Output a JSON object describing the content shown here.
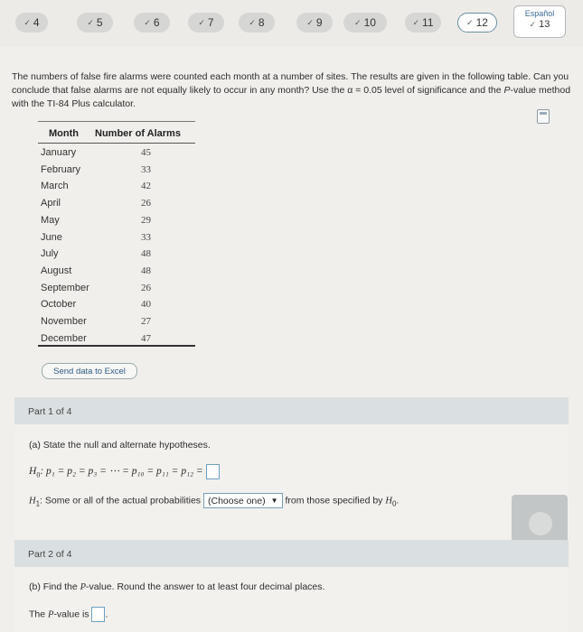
{
  "nav": {
    "questions": [
      {
        "label": "4",
        "check": "✓",
        "current": false
      },
      {
        "label": "5",
        "check": "✓",
        "current": false
      },
      {
        "label": "6",
        "check": "✓",
        "current": false
      },
      {
        "label": "7",
        "check": "✓",
        "current": false
      },
      {
        "label": "8",
        "check": "✓",
        "current": false
      },
      {
        "label": "9",
        "check": "✓",
        "current": false
      },
      {
        "label": "10",
        "check": "✓",
        "current": false
      },
      {
        "label": "11",
        "check": "✓",
        "current": false
      },
      {
        "label": "12",
        "check": "✓",
        "current": true
      }
    ],
    "language": {
      "label": "Español",
      "number": "13",
      "check": "✓"
    }
  },
  "question": {
    "text_1": "The numbers of false fire alarms were counted each month at a number of sites. The results are given in the following table. Can you conclude that false alarms are not equally likely to occur in any month? Use the α = 0.05 level of significance and the ",
    "text_italic": "P",
    "text_2": "-value method with the TI-84 Plus calculator."
  },
  "table": {
    "headers": [
      "Month",
      "Number of Alarms"
    ],
    "rows": [
      [
        "January",
        "45"
      ],
      [
        "February",
        "33"
      ],
      [
        "March",
        "42"
      ],
      [
        "April",
        "26"
      ],
      [
        "May",
        "29"
      ],
      [
        "June",
        "33"
      ],
      [
        "July",
        "48"
      ],
      [
        "August",
        "48"
      ],
      [
        "September",
        "26"
      ],
      [
        "October",
        "40"
      ],
      [
        "November",
        "27"
      ],
      [
        "December",
        "47"
      ]
    ]
  },
  "send_button": "Send data to Excel",
  "part1": {
    "title": "Part 1 of 4",
    "instruction": "(a) State the null and alternate hypotheses.",
    "h0_label": "H",
    "h0_sub": "0",
    "h0_expr": ": p₁ = p₂ = p₃ = ⋯ = p₁₀ = p₁₁ = p₁₂ =",
    "h1_label": "H",
    "h1_sub": "1",
    "h1_text": ": Some or all of the actual probabilities",
    "dropdown_value": "(Choose one)",
    "dropdown_arrow": "▼",
    "h1_text_2": "from those specified by",
    "h1_ref": "H",
    "h1_ref_sub": "0",
    "h1_end": "."
  },
  "part2": {
    "title": "Part 2 of 4",
    "instruction_1": "(b) Find the ",
    "instruction_italic": "P",
    "instruction_2": "-value. Round the answer to at least four decimal places.",
    "answer_prefix_1": "The ",
    "answer_prefix_italic": "P",
    "answer_prefix_2": "-value is",
    "answer_suffix": "."
  }
}
